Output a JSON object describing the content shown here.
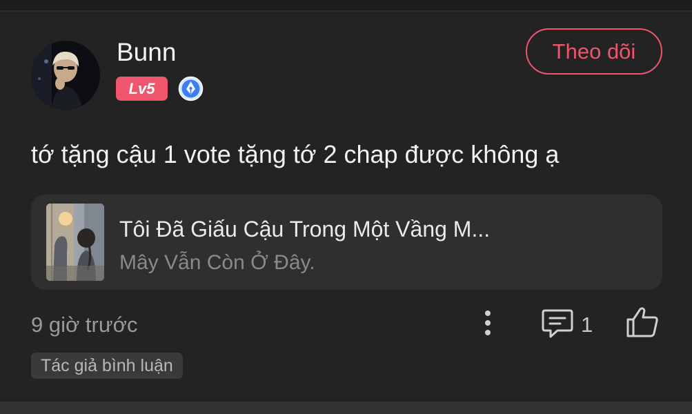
{
  "comment": {
    "user": {
      "name": "Bunn",
      "level": "Lv5",
      "avatar_icon": "avatar-photo",
      "badge_icon": "author-pen-icon"
    },
    "follow_label": "Theo dõi",
    "text": "tớ tặng cậu 1 vote tặng tớ 2 chap được không ạ",
    "book": {
      "title": "Tôi Đã Giấu Cậu Trong Một Vầng M...",
      "subtitle": "Mây Vẫn Còn Ở Đây."
    },
    "timestamp": "9 giờ trước",
    "reply_count": "1",
    "author_tag": "Tác giả bình luận"
  },
  "colors": {
    "background": "#232323",
    "accent": "#f0556e",
    "card": "#2f2f2f",
    "muted_text": "#9a9a9a"
  }
}
